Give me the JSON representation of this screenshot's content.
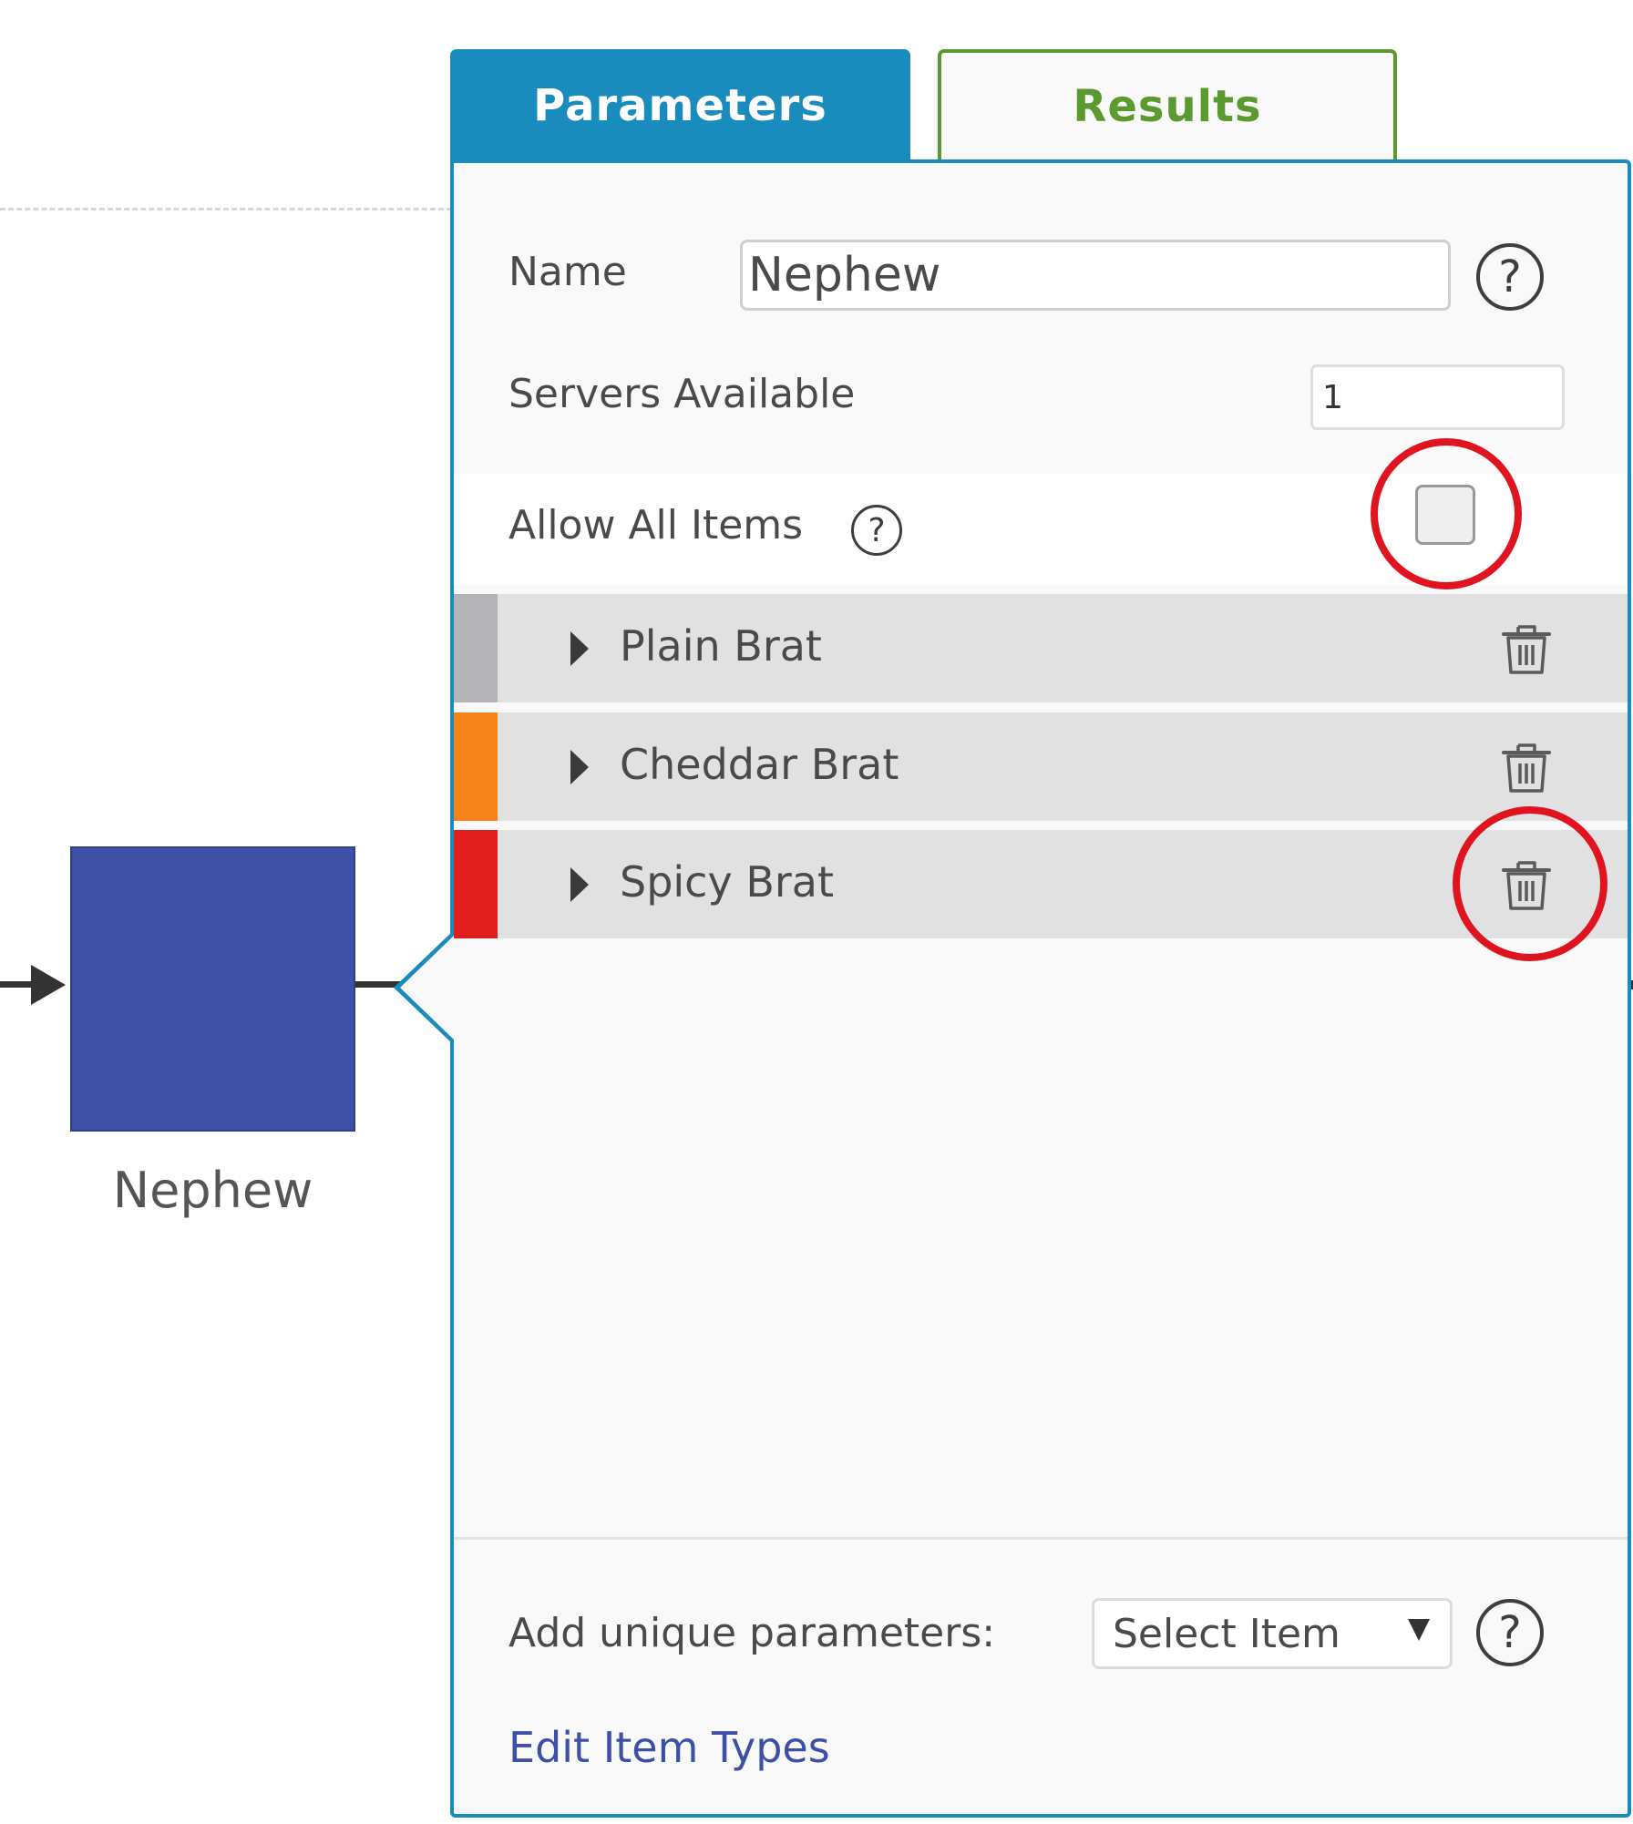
{
  "canvas": {
    "node_label": "Nephew",
    "node_color": "#3d50a6"
  },
  "tabs": [
    {
      "label": "Parameters",
      "active": true
    },
    {
      "label": "Results",
      "active": false
    }
  ],
  "form": {
    "name_label": "Name",
    "name_value": "Nephew",
    "servers_label": "Servers Available",
    "servers_value": "1",
    "allow_all_label": "Allow All Items",
    "allow_all_checked": false
  },
  "items": [
    {
      "label": "Plain Brat",
      "color": "#b4b4b6"
    },
    {
      "label": "Cheddar Brat",
      "color": "#f7841a"
    },
    {
      "label": "Spicy Brat",
      "color": "#e01e1e"
    }
  ],
  "footer": {
    "add_label": "Add unique parameters:",
    "select_value": "Select Item",
    "edit_link": "Edit Item Types"
  },
  "icons": {
    "help": "?",
    "trash": "trash-icon",
    "caret": "caret-right-icon"
  },
  "colors": {
    "accent": "#1a8bbd",
    "results_tab": "#5a9a2e",
    "highlight": "#e0141e",
    "link": "#3d50a6"
  }
}
